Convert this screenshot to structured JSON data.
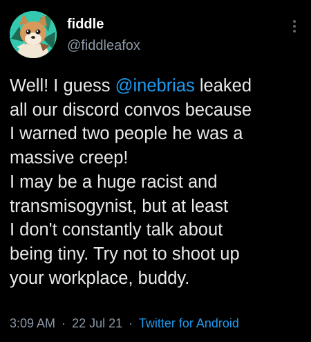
{
  "tweet": {
    "display_name": "fiddle",
    "handle": "@fiddleafox",
    "text_lines": [
      {
        "before": "Well! I guess ",
        "mention": "@inebrias",
        "after": " leaked"
      },
      {
        "text": "all our discord convos because"
      },
      {
        "text": "I warned two people he was a"
      },
      {
        "text": "massive creep!"
      },
      {
        "text": "I may be a huge racist and"
      },
      {
        "text": "transmisogynist, but at least"
      },
      {
        "text": "I don't constantly talk about"
      },
      {
        "text": "being tiny. Try not to shoot up"
      },
      {
        "text": "your workplace, buddy."
      }
    ],
    "time": "3:09 AM",
    "date": "22 Jul 21",
    "separator": "·",
    "source": "Twitter for Android"
  },
  "icons": {
    "more": "more-vertical-icon",
    "avatar": "fox-avatar-image"
  },
  "colors": {
    "background": "#000000",
    "text": "#e7e9ea",
    "secondary": "#8b98a5",
    "accent": "#1d9bf0",
    "avatar_bg": "#33c9b0"
  }
}
